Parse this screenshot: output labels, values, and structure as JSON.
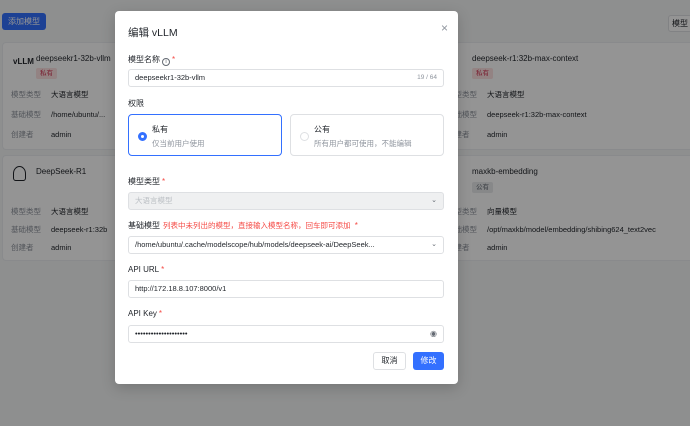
{
  "background": {
    "add_model_label": "添加模型",
    "top_right_btn": "模型",
    "cards": [
      {
        "logo": "vLLM",
        "title": "deepseekr1-32b-vllm",
        "badge": "私有",
        "type_key": "模型类型",
        "type_val": "大语言模型",
        "base_key": "基础模型",
        "base_val": "/home/ubuntu/...",
        "creator_key": "创建者",
        "creator_val": "admin"
      },
      {
        "logo": "",
        "title": "deepseek-r1:32b-max-context",
        "badge": "私有",
        "type_key": "模型类型",
        "type_val": "大语言模型",
        "base_key": "基础模型",
        "base_val": "deepseek-r1:32b-max-context",
        "creator_key": "创建者",
        "creator_val": "admin"
      },
      {
        "logo": "",
        "title": "DeepSeek-R1",
        "badge": "",
        "type_key": "模型类型",
        "type_val": "大语言模型",
        "base_key": "基础模型",
        "base_val": "deepseek-r1:32b",
        "creator_key": "创建者",
        "creator_val": "admin"
      },
      {
        "logo": "",
        "title": "maxkb-embedding",
        "badge": "公有",
        "type_key": "模型类型",
        "type_val": "向量模型",
        "base_key": "基础模型",
        "base_val": "/opt/maxkb/model/embedding/shibing624_text2vec",
        "creator_key": "创建者",
        "creator_val": "admin"
      }
    ]
  },
  "dialog": {
    "title": "编辑 vLLM",
    "close_icon": "×",
    "model_name_label": "模型名称",
    "model_name_value": "deepseekr1-32b-vllm",
    "model_name_counter": "19 / 64",
    "permission_label": "权限",
    "perm_private_title": "私有",
    "perm_private_desc": "仅当前用户使用",
    "perm_public_title": "公有",
    "perm_public_desc": "所有用户都可使用，不能编辑",
    "model_type_label": "模型类型",
    "model_type_value": "大语言模型",
    "base_model_label": "基础模型",
    "base_model_hint": "列表中未列出的模型，直接输入模型名称，回车即可添加",
    "base_model_value": "/home/ubuntu/.cache/modelscope/hub/models/deepseek-ai/DeepSeek...",
    "api_url_label": "API URL",
    "api_url_value": "http://172.18.8.107:8000/v1",
    "api_key_label": "API Key",
    "api_key_value": "••••••••••••••••••••",
    "cancel_label": "取消",
    "ok_label": "修改"
  }
}
